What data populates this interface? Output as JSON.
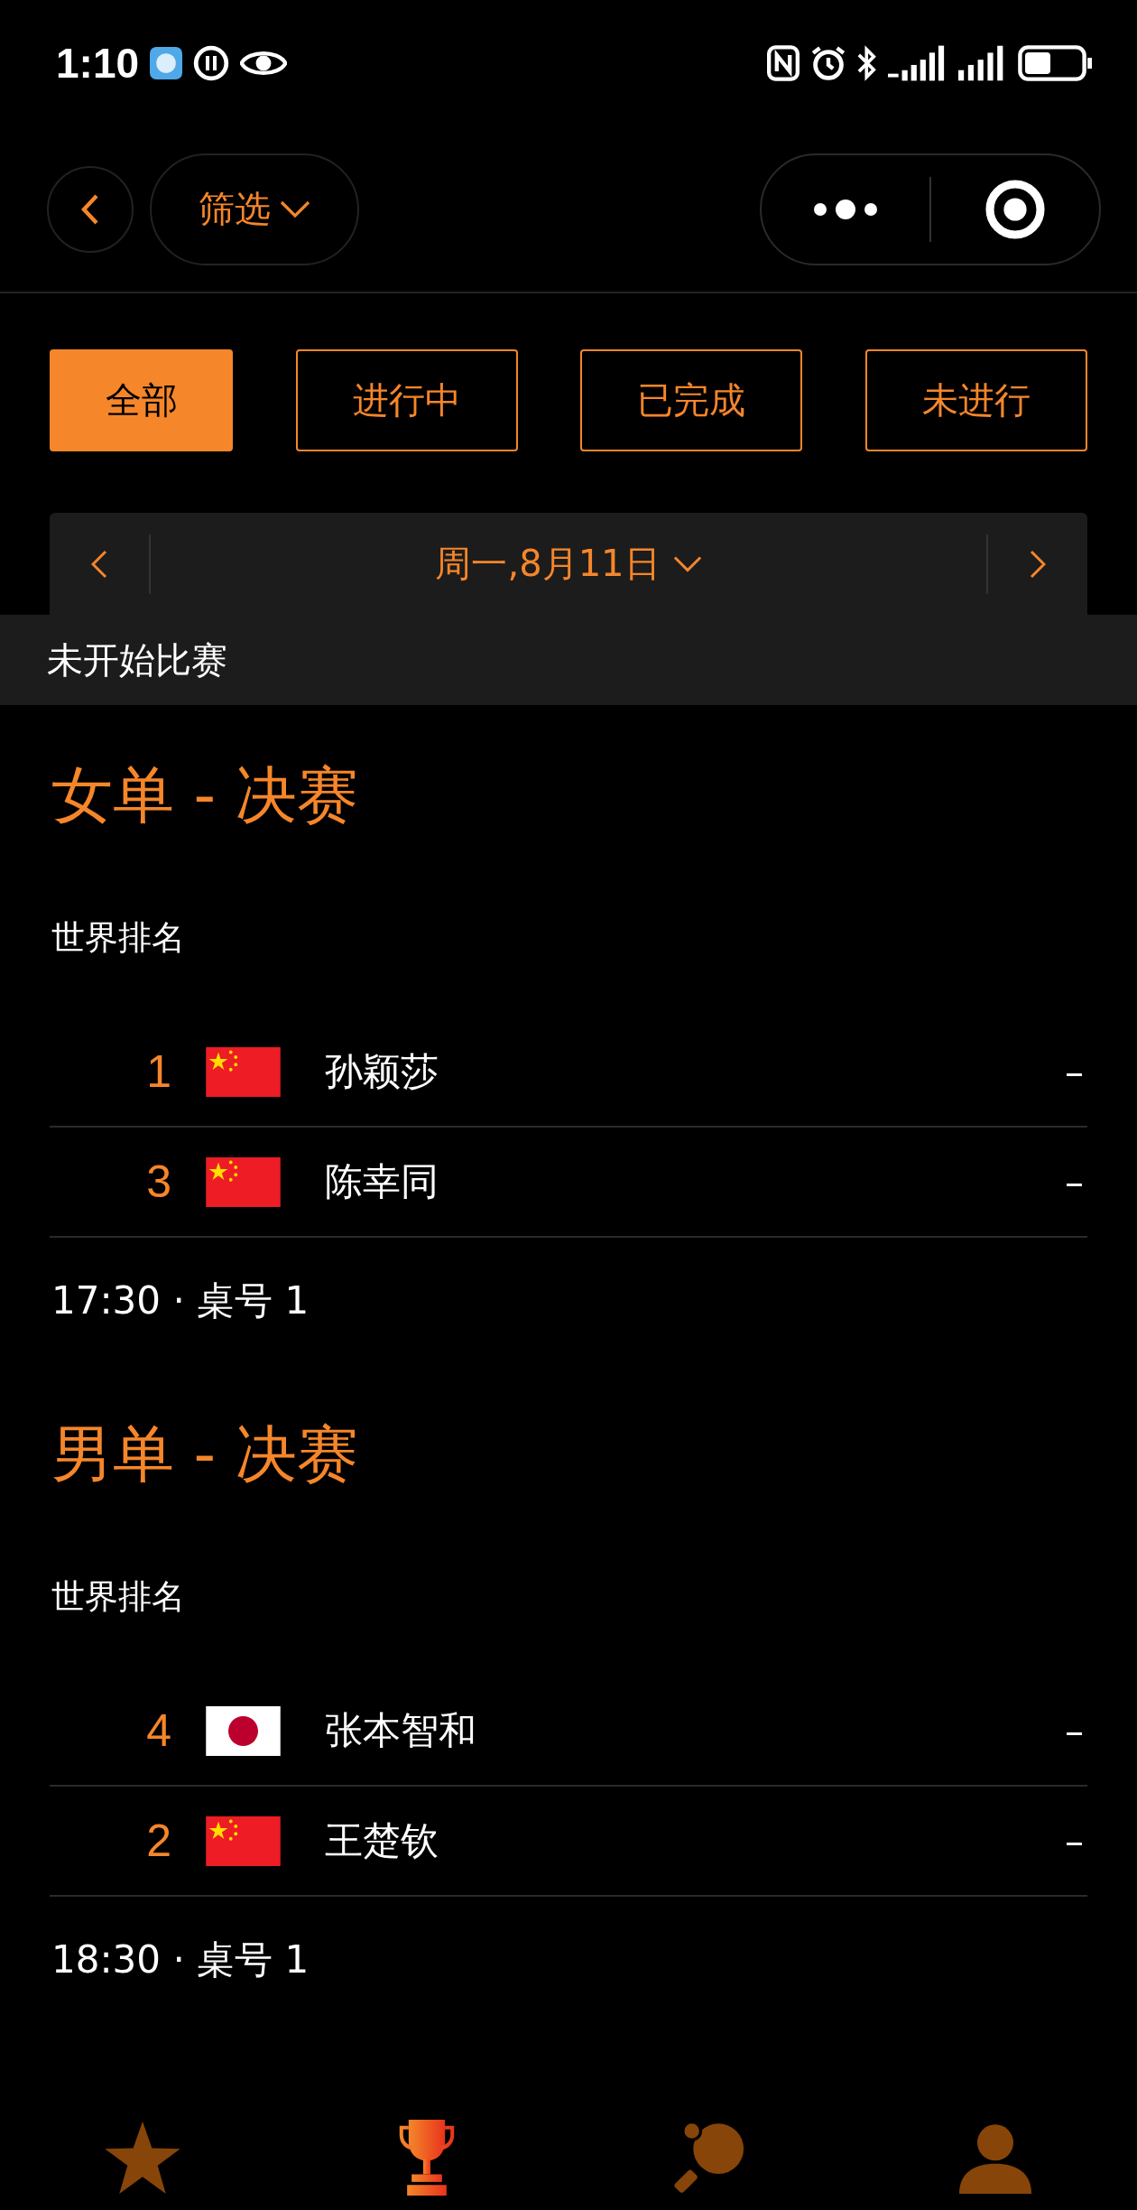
{
  "status_bar": {
    "time": "1:10"
  },
  "header": {
    "filter_label": "筛选"
  },
  "filters": [
    {
      "label": "全部",
      "selected": true
    },
    {
      "label": "进行中",
      "selected": false
    },
    {
      "label": "已完成",
      "selected": false
    },
    {
      "label": "未进行",
      "selected": false
    }
  ],
  "date_bar": {
    "date": "周一,8月11日"
  },
  "section": {
    "title": "未开始比赛"
  },
  "matches": [
    {
      "title": "女单 - 决赛",
      "ranking_label": "世界排名",
      "players": [
        {
          "rank": "1",
          "kind": "china",
          "name": "孙颖莎",
          "score": "–"
        },
        {
          "rank": "3",
          "kind": "china",
          "name": "陈幸同",
          "score": "–"
        }
      ],
      "info": "17:30 · 桌号 1"
    },
    {
      "title": "男单 - 决赛",
      "ranking_label": "世界排名",
      "players": [
        {
          "rank": "4",
          "kind": "japan",
          "name": "张本智和",
          "score": "–"
        },
        {
          "rank": "2",
          "kind": "china",
          "name": "王楚钦",
          "score": "–"
        }
      ],
      "info": "18:30 · 桌号 1"
    }
  ],
  "bottom_nav": [
    {
      "kind": "star",
      "selected": false
    },
    {
      "kind": "trophy",
      "selected": true
    },
    {
      "kind": "paddle",
      "selected": false
    },
    {
      "kind": "person",
      "selected": false
    }
  ]
}
